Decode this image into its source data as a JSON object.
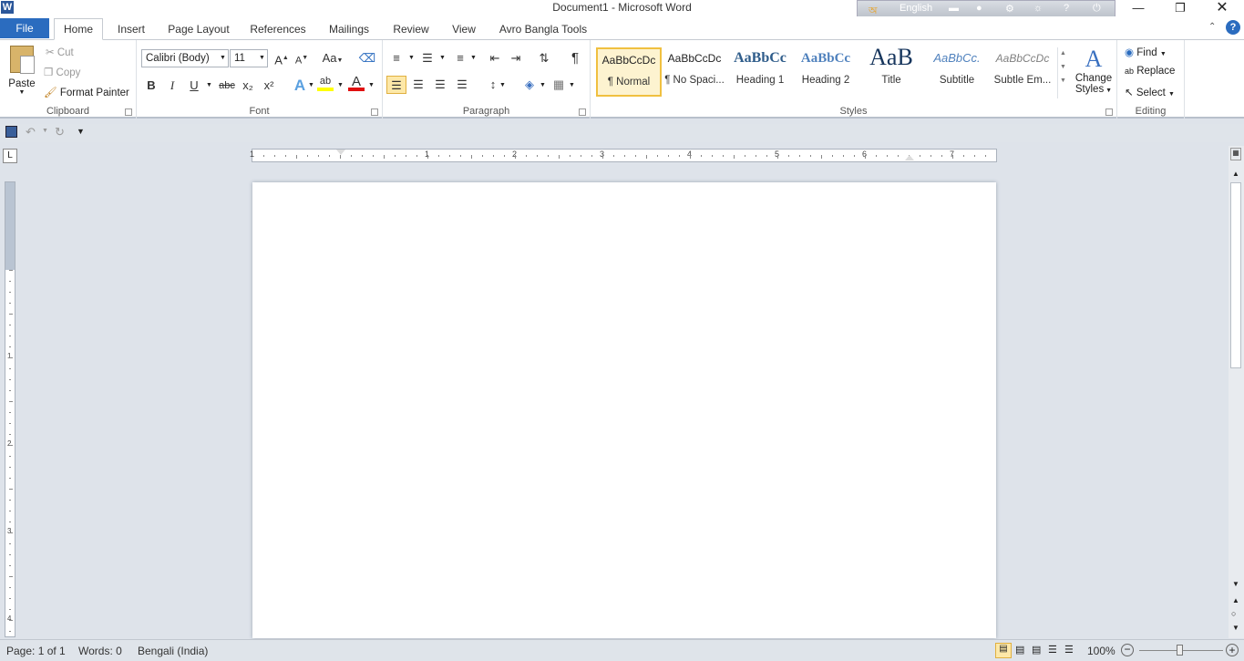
{
  "window": {
    "title": "Document1 - Microsoft Word",
    "app_icon": "W"
  },
  "avro": {
    "language": "English"
  },
  "tabs": [
    {
      "label": "File"
    },
    {
      "label": "Home"
    },
    {
      "label": "Insert"
    },
    {
      "label": "Page Layout"
    },
    {
      "label": "References"
    },
    {
      "label": "Mailings"
    },
    {
      "label": "Review"
    },
    {
      "label": "View"
    },
    {
      "label": "Avro Bangla Tools"
    }
  ],
  "clipboard": {
    "group": "Clipboard",
    "paste": "Paste",
    "cut": "Cut",
    "copy": "Copy",
    "format_painter": "Format Painter"
  },
  "font": {
    "group": "Font",
    "name": "Calibri (Body)",
    "size": "11",
    "bold": "B",
    "italic": "I",
    "underline": "U",
    "strike": "abc",
    "sub": "x₂",
    "sup": "x²",
    "change_case": "Aa",
    "font_color": "A"
  },
  "paragraph": {
    "group": "Paragraph",
    "show_marks": "¶"
  },
  "styles": {
    "group": "Styles",
    "items": [
      {
        "preview": "AaBbCcDc",
        "name": "¶ Normal"
      },
      {
        "preview": "AaBbCcDc",
        "name": "¶ No Spaci..."
      },
      {
        "preview": "AaBbCc",
        "name": "Heading 1"
      },
      {
        "preview": "AaBbCc",
        "name": "Heading 2"
      },
      {
        "preview": "AaB",
        "name": "Title"
      },
      {
        "preview": "AaBbCc.",
        "name": "Subtitle"
      },
      {
        "preview": "AaBbCcDc",
        "name": "Subtle Em..."
      }
    ],
    "change_styles_1": "Change",
    "change_styles_2": "Styles"
  },
  "editing": {
    "group": "Editing",
    "find": "Find",
    "replace": "Replace",
    "select": "Select"
  },
  "ruler": {
    "numbers": [
      "1",
      "1",
      "2",
      "3",
      "4",
      "5",
      "6",
      "7"
    ],
    "vnumbers": [
      "1",
      "2",
      "3",
      "4"
    ]
  },
  "status": {
    "page": "Page: 1 of 1",
    "words": "Words: 0",
    "language": "Bengali (India)",
    "zoom": "100%"
  },
  "colors": {
    "accent": "#2b579a",
    "file_tab": "#2b6cbf",
    "font_color": "#e01010",
    "highlight": "#ffff00"
  }
}
